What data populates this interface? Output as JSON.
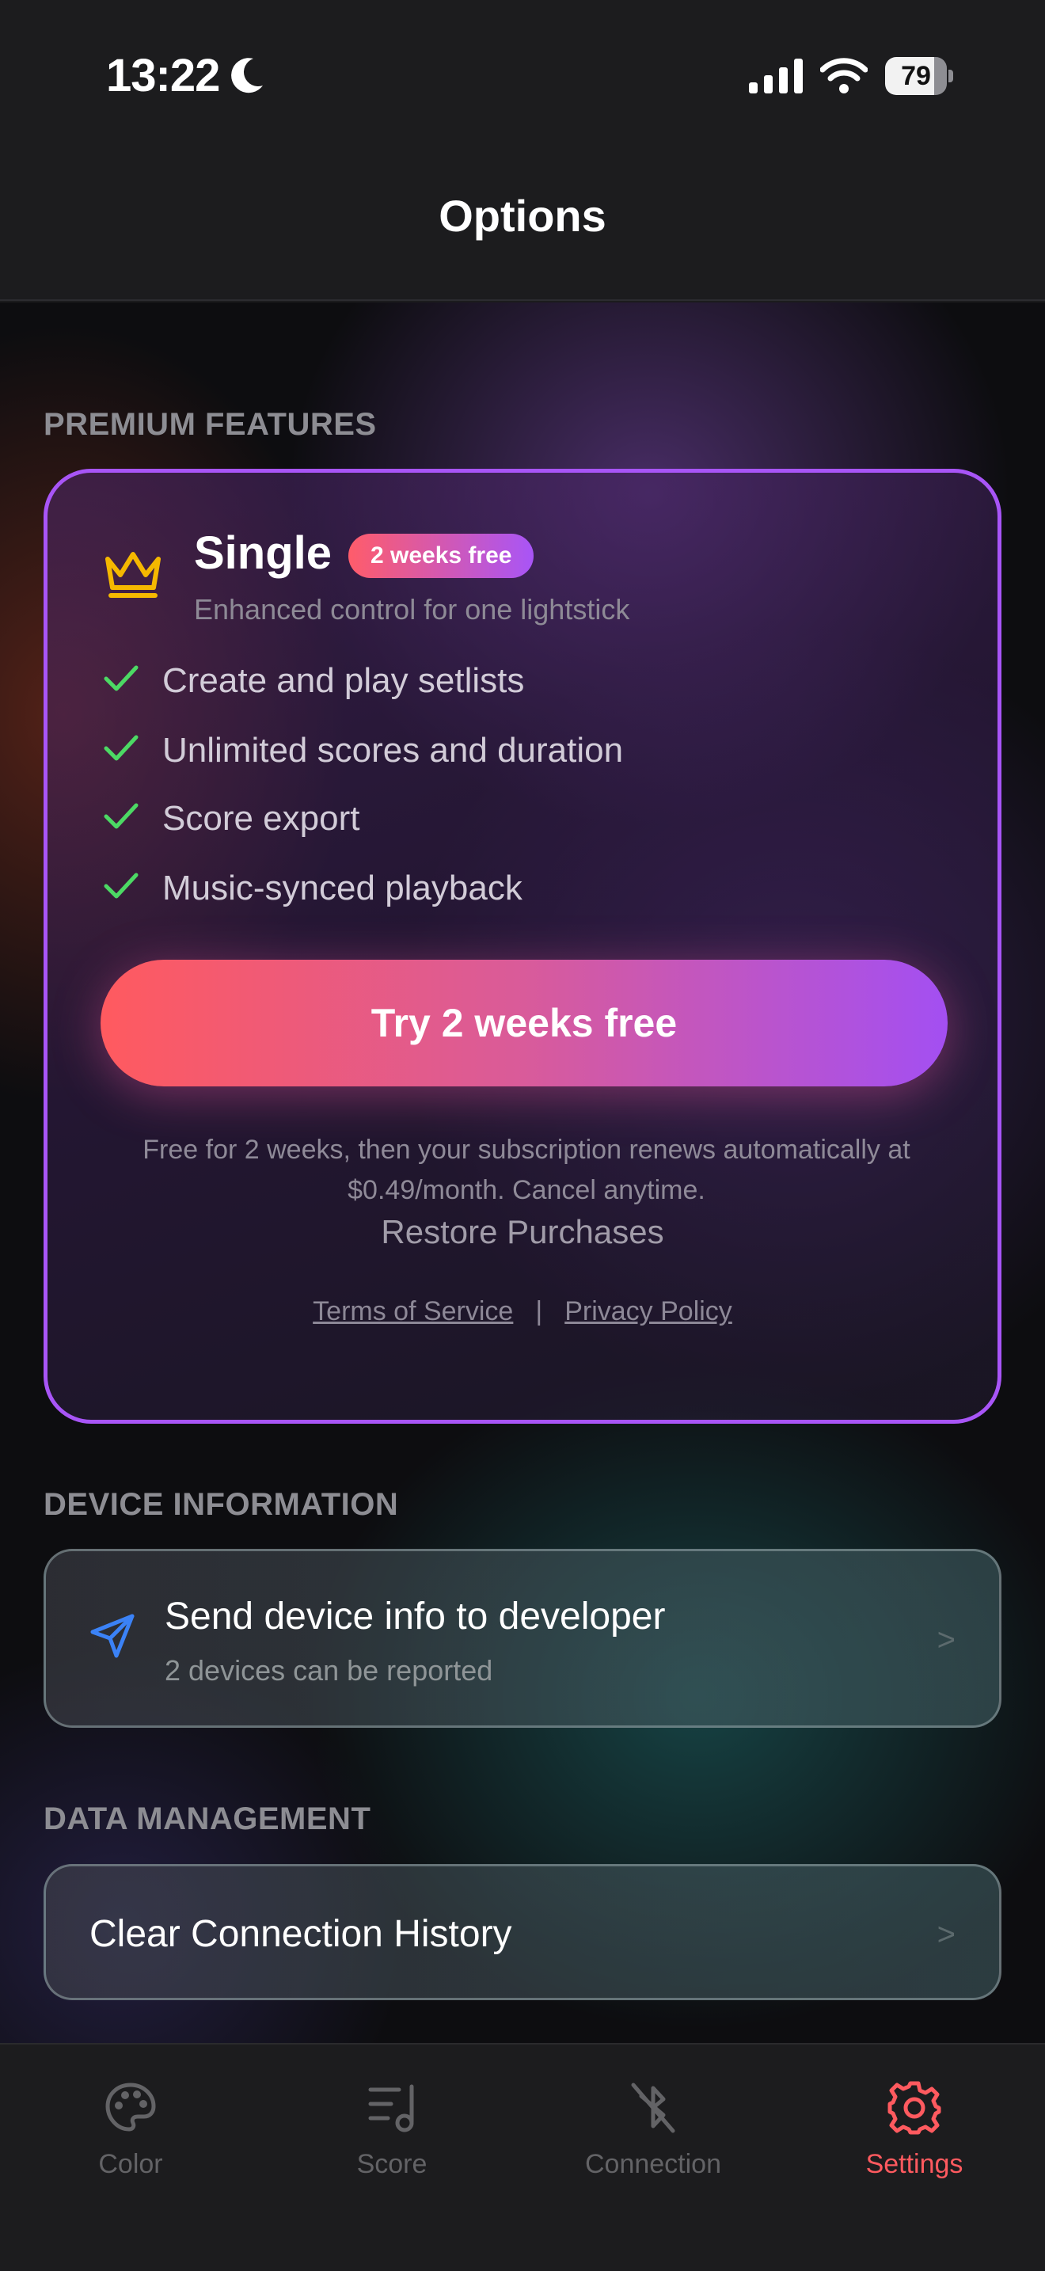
{
  "status_bar": {
    "time": "13:22",
    "battery": "79",
    "battery_level": 0.79,
    "icons": [
      "moon-icon",
      "cellular-signal-icon",
      "wifi-icon",
      "battery-icon"
    ]
  },
  "header": {
    "title": "Options"
  },
  "premium": {
    "section_label": "PREMIUM FEATURES",
    "plan_name": "Single",
    "badge": "2 weeks free",
    "subtitle": "Enhanced control for one lightstick",
    "features": [
      "Create and play setlists",
      "Unlimited scores and duration",
      "Score export",
      "Music-synced playback"
    ],
    "cta": "Try 2 weeks free",
    "note": "Free for 2 weeks, then your subscription renews automatically at $0.49/month. Cancel anytime.",
    "restore": "Restore Purchases",
    "terms": "Terms of Service",
    "separator": "|",
    "privacy": "Privacy Policy",
    "accent_color": "#a855f7",
    "gradient_start": "#ff5a5f",
    "gradient_end": "#a34ff2"
  },
  "device_info": {
    "section_label": "DEVICE INFORMATION",
    "title": "Send device info to developer",
    "subtitle": "2 devices can be reported",
    "chevron": ">"
  },
  "data_management": {
    "section_label": "DATA MANAGEMENT",
    "title": "Clear Connection History",
    "chevron": ">"
  },
  "tabs": [
    {
      "label": "Color",
      "icon": "palette-icon",
      "active": false
    },
    {
      "label": "Score",
      "icon": "score-icon",
      "active": false
    },
    {
      "label": "Connection",
      "icon": "bluetooth-off-icon",
      "active": false
    },
    {
      "label": "Settings",
      "icon": "gear-icon",
      "active": true
    }
  ],
  "active_color": "#ff5a5f"
}
